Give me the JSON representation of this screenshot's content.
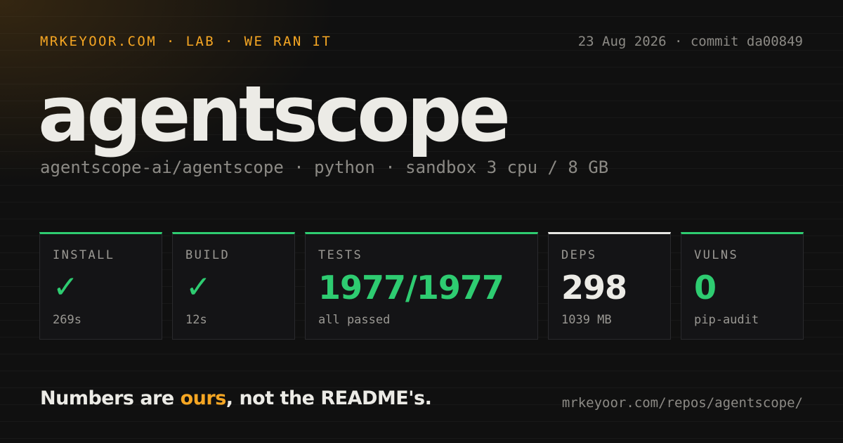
{
  "header": {
    "kicker": "MRKEYOOR.COM · LAB · WE RAN IT",
    "meta": "23 Aug 2026 · commit da00849"
  },
  "repo": {
    "name": "agentscope",
    "subtitle": "agentscope-ai/agentscope · python · sandbox 3 cpu / 8 GB"
  },
  "cards": [
    {
      "label": "INSTALL",
      "value": "✓",
      "sub": "269s"
    },
    {
      "label": "BUILD",
      "value": "✓",
      "sub": "12s"
    },
    {
      "label": "TESTS",
      "value": "1977/1977",
      "sub": "all passed"
    },
    {
      "label": "DEPS",
      "value": "298",
      "sub": "1039 MB"
    },
    {
      "label": "VULNS",
      "value": "0",
      "sub": "pip-audit"
    }
  ],
  "footer": {
    "tagline_before": "Numbers are ",
    "tagline_accent": "ours",
    "tagline_after": ", not the README's.",
    "url": "mrkeyoor.com/repos/agentscope/"
  },
  "colors": {
    "accent": "#f5a623",
    "success": "#2ecc71",
    "neutral": "#e6e6e3",
    "background": "#101010"
  }
}
